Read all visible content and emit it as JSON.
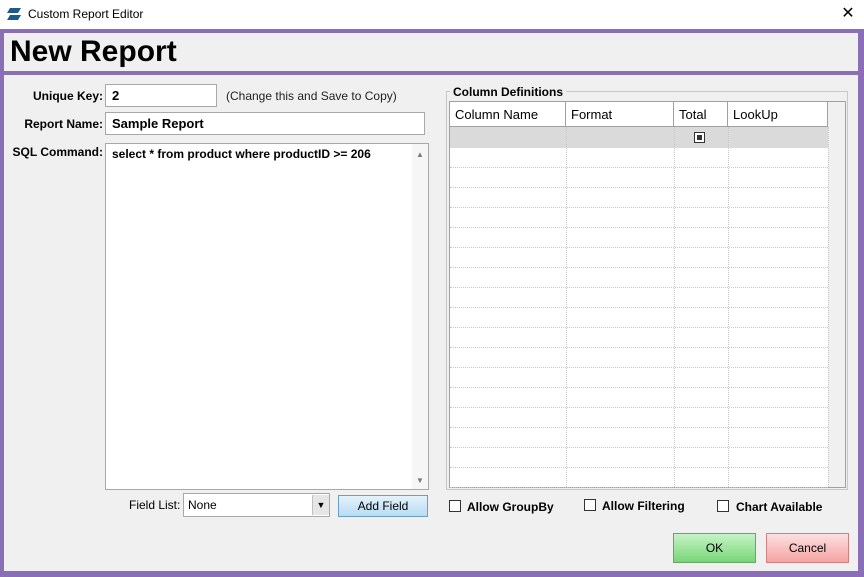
{
  "window": {
    "title": "Custom Report Editor",
    "close_glyph": "✕"
  },
  "header": {
    "title": "New Report"
  },
  "form": {
    "unique_key_label": "Unique Key:",
    "unique_key_value": "2",
    "unique_key_hint": "(Change  this and Save to Copy)",
    "report_name_label": "Report Name:",
    "report_name_value": "Sample Report",
    "sql_label": "SQL Command:",
    "sql_value": "select * from product where productID >= 206",
    "field_list_label": "Field List:",
    "field_list_selected": "None",
    "add_field_label": "Add Field"
  },
  "columns": {
    "group_title": "Column Definitions",
    "headers": [
      "Column Name",
      "Format",
      "Total",
      "LookUp"
    ],
    "first_row_total_checked": true
  },
  "options": {
    "allow_groupby": "Allow GroupBy",
    "allow_filtering": "Allow Filtering",
    "chart_available": "Chart Available"
  },
  "buttons": {
    "ok": "OK",
    "cancel": "Cancel"
  },
  "colors": {
    "frame": "#8a6fb6",
    "ok": "#78d678",
    "cancel": "#f5a3a3",
    "add_field": "#b8dcf3"
  }
}
